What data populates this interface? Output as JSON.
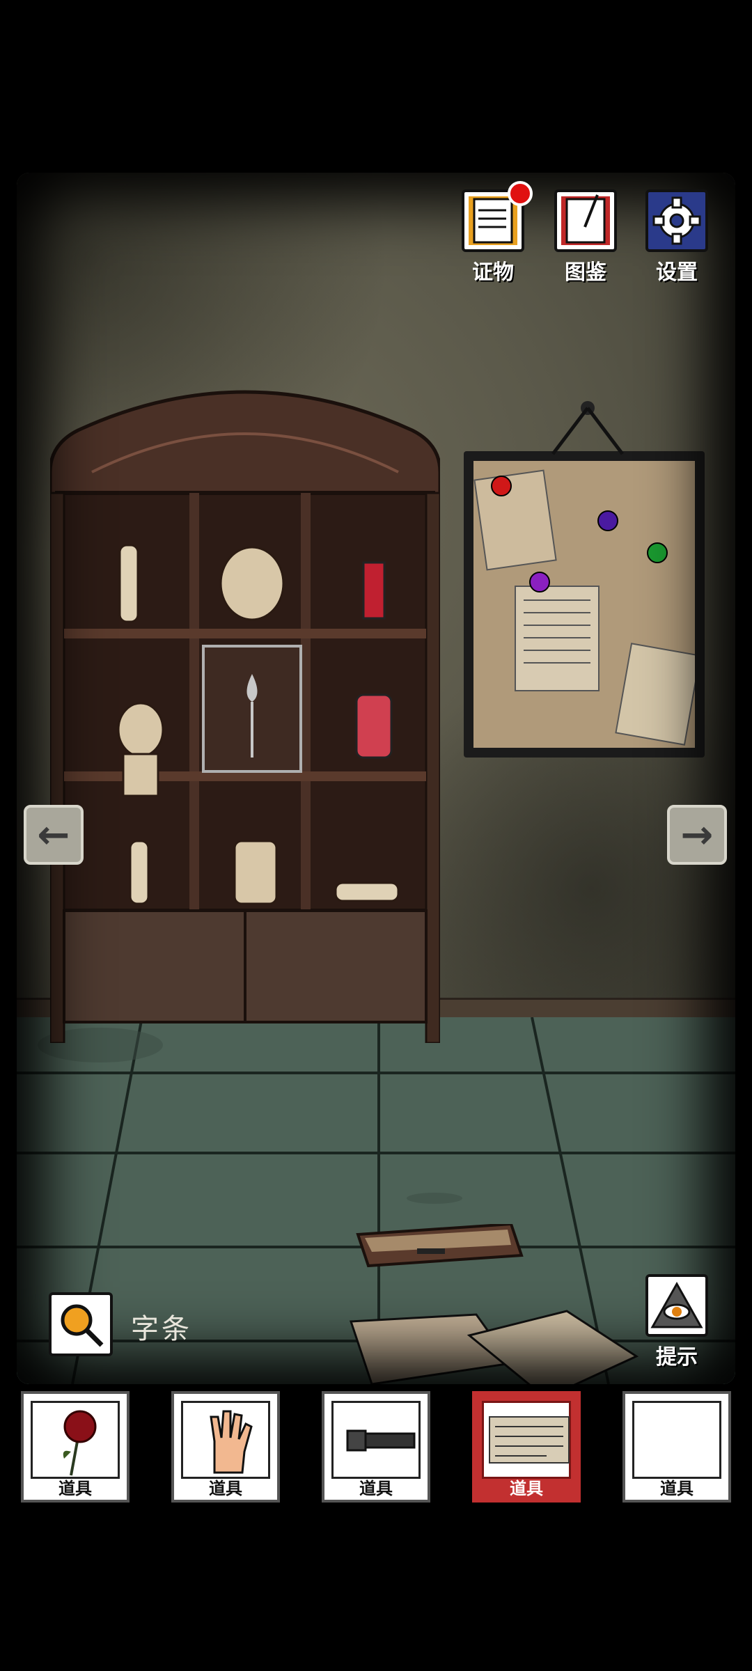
{
  "hud": {
    "evidence_label": "证物",
    "codex_label": "图鉴",
    "settings_label": "设置",
    "hint_label": "提示"
  },
  "selected_item_name": "字条",
  "inventory": [
    {
      "label": "道具",
      "icon": "rose-icon"
    },
    {
      "label": "道具",
      "icon": "doll-hand-icon"
    },
    {
      "label": "道具",
      "icon": "flashlight-icon"
    },
    {
      "label": "道具",
      "icon": "note-icon",
      "selected": true
    },
    {
      "label": "道具",
      "icon": "empty"
    }
  ],
  "colors": {
    "selected_slot": "#c23030",
    "notification_dot": "#e01010"
  }
}
